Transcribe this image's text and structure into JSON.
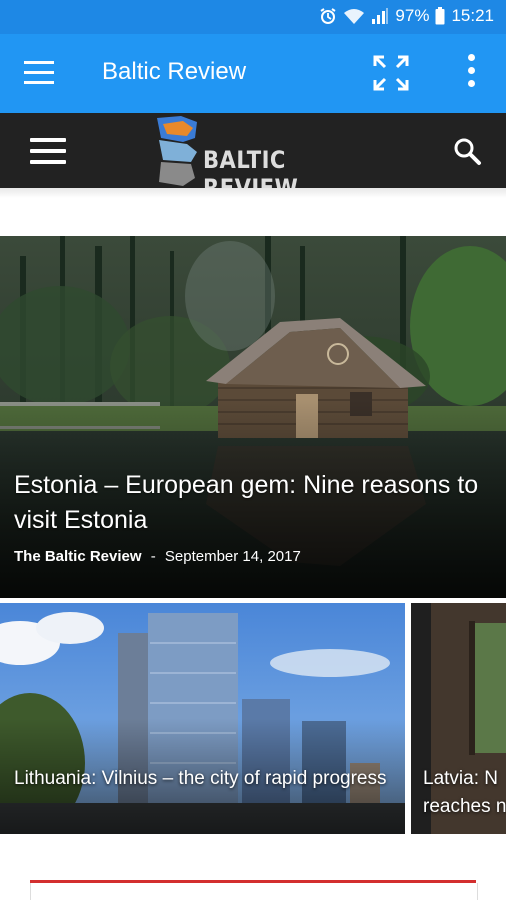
{
  "status_bar": {
    "battery": "97%",
    "time": "15:21"
  },
  "app_bar": {
    "title": "Baltic Review"
  },
  "site": {
    "logo_text": "BALTIC REVIEW"
  },
  "hero": {
    "title": "Estonia – European gem: Nine reasons to visit Estonia",
    "author": "The Baltic Review",
    "separator": "-",
    "date": "September 14, 2017"
  },
  "cards": [
    {
      "title": "Lithuania: Vilnius – the city of rapid progress"
    },
    {
      "title": "Latvia: N reaches n"
    }
  ],
  "colors": {
    "status": "#1e88e5",
    "app_bar": "#2196f3",
    "site_bar": "#222222",
    "accent_red": "#d32f2f"
  },
  "icons": [
    "alarm-icon",
    "wifi-icon",
    "signal-icon",
    "battery-icon",
    "menu-icon",
    "fullscreen-icon",
    "more-vert-icon",
    "site-menu-icon",
    "search-icon"
  ]
}
